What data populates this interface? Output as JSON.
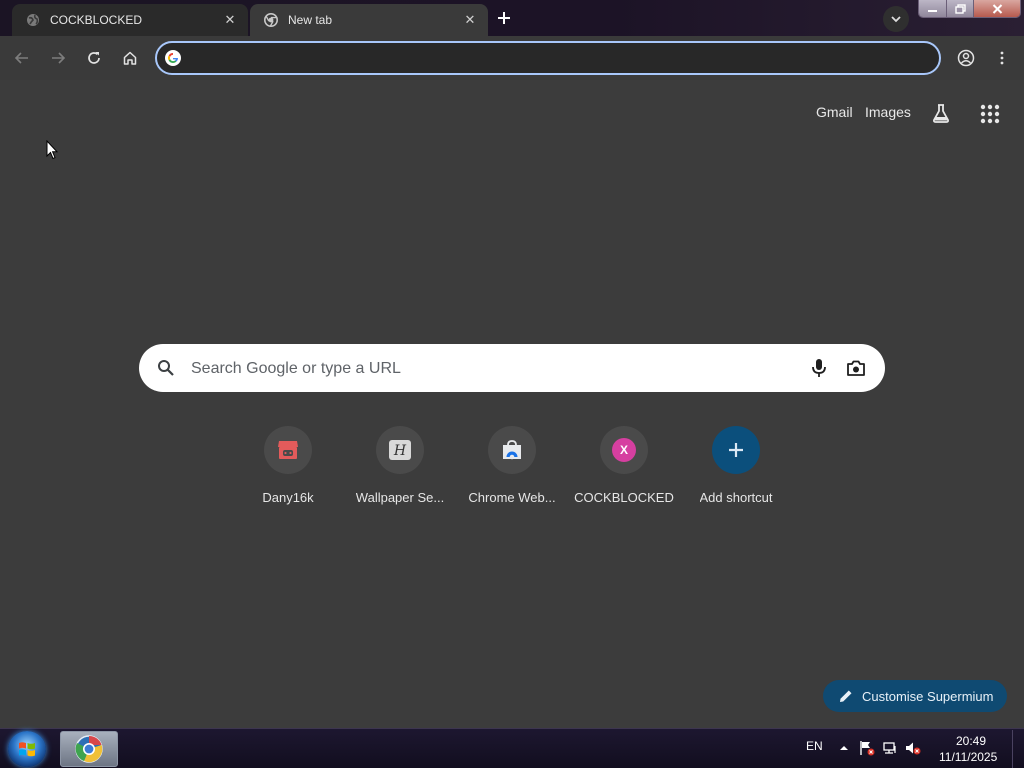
{
  "tabs": [
    {
      "title": "COCKBLOCKED",
      "active": false
    },
    {
      "title": "New tab",
      "active": true
    }
  ],
  "toolbar": {
    "back_icon": "arrow-left-icon",
    "forward_icon": "arrow-right-icon",
    "reload_icon": "reload-icon",
    "home_icon": "home-icon",
    "omnibox_value": ""
  },
  "top_links": {
    "gmail": "Gmail",
    "images": "Images"
  },
  "search": {
    "placeholder": "Search Google or type a URL"
  },
  "shortcuts": [
    {
      "label": "Dany16k",
      "icon": "store-icon"
    },
    {
      "label": "Wallpaper Se...",
      "icon": "h-letter-icon"
    },
    {
      "label": "Chrome Web...",
      "icon": "web-store-icon"
    },
    {
      "label": "COCKBLOCKED",
      "icon": "x-letter-icon",
      "letter": "X"
    },
    {
      "label": "Add shortcut",
      "icon": "plus-icon"
    }
  ],
  "customise": {
    "label": "Customise Supermium"
  },
  "taskbar": {
    "language": "EN",
    "time": "20:49",
    "date": "11/11/2025"
  },
  "colors": {
    "background": "#3c3c3c",
    "omnibox_focus": "#a8c7fa",
    "customise_bg": "#0f4a72",
    "add_shortcut_bg": "#0b4f7c"
  }
}
